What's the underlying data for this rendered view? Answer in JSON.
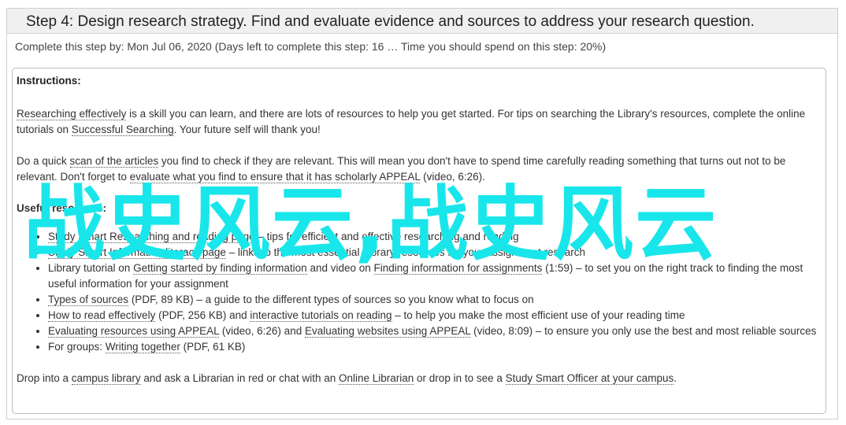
{
  "header": {
    "title": "Step 4: Design research strategy. Find and evaluate evidence and sources to address your research question.",
    "due": "Complete this step by: Mon Jul 06, 2020 (Days left to complete this step: 16 … Time you should spend on this step: 20%)"
  },
  "instructions": {
    "title": "Instructions:",
    "p1": {
      "link1": "Researching effectively",
      "text1": " is a skill you can learn, and there are lots of resources to help you get started. For tips on searching the Library's resources, complete the online tutorials on ",
      "link2": "Successful Searching",
      "text2": ". Your future self will thank you!"
    },
    "p2": {
      "text1": "Do a quick ",
      "link1": "scan of the articles",
      "text2": " you find to check if they are relevant. This will mean you don't have to spend time carefully reading something that turns out not to be relevant. Don't forget to ",
      "link2": "evaluate what you find to ensure that it has scholarly APPEAL",
      "text3": " (video, 6:26)."
    },
    "resources_title": "Useful resources:",
    "items": {
      "i1": {
        "text1": "",
        "link1": "Study Smart Researching and reading page",
        "text2": " – tips for efficient and effective researching and reading"
      },
      "i2": {
        "text1": "",
        "link1": "Study Smart Information literacy page",
        "text2": " – links to the most essential Library resources for your assignment research"
      },
      "i3": {
        "text1": "Library tutorial on ",
        "link1": "Getting started by finding information",
        "text2": " and video on ",
        "link2": "Finding information for assignments",
        "text3": " (1:59) – to set you on the right track to finding the most useful information for your assignment"
      },
      "i4": {
        "link1": "Types of sources",
        "text1": " (PDF, 89 KB) – a guide to the different types of sources so you know what to focus on"
      },
      "i5": {
        "link1": "How to read effectively",
        "text1": " (PDF, 256 KB) and ",
        "link2": "interactive tutorials on reading",
        "text2": " – to help you make the most efficient use of your reading time"
      },
      "i6": {
        "link1": "Evaluating resources using APPEAL",
        "text1": " (video, 6:26) and ",
        "link2": "Evaluating websites using APPEAL",
        "text2": " (video, 8:09) – to ensure you only use the best and most reliable sources"
      },
      "i7": {
        "text1": "For groups: ",
        "link1": "Writing together",
        "text2": " (PDF, 61 KB)"
      }
    },
    "footer": {
      "text1": "Drop into a ",
      "link1": "campus library",
      "text2": " and ask a Librarian in red or chat with an ",
      "link2": "Online Librarian",
      "text3": " or drop in to see a ",
      "link3": "Study Smart Officer at your campus",
      "text4": "."
    }
  },
  "watermark": "战史风云,战史风云",
  "colors": {
    "watermark": "#19e6ea",
    "header_bg": "#f0f0f0"
  }
}
